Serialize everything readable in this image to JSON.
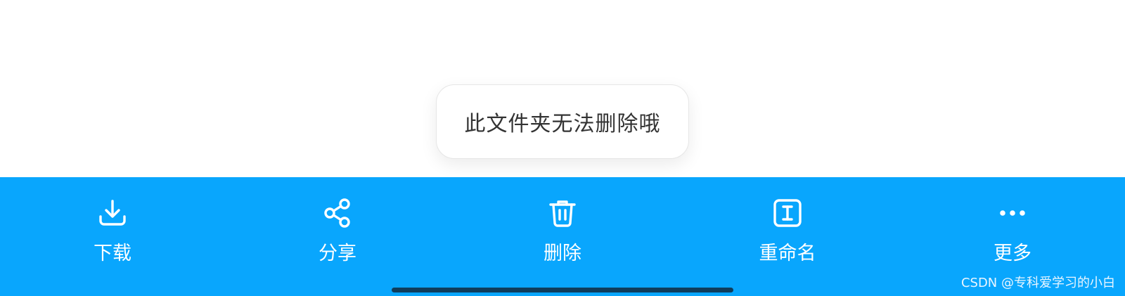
{
  "toast": {
    "message": "此文件夹无法删除哦"
  },
  "toolbar": {
    "background": "#09a6fd",
    "items": [
      {
        "label": "下载",
        "icon": "download-icon"
      },
      {
        "label": "分享",
        "icon": "share-icon"
      },
      {
        "label": "删除",
        "icon": "trash-icon"
      },
      {
        "label": "重命名",
        "icon": "rename-icon"
      },
      {
        "label": "更多",
        "icon": "more-icon"
      }
    ]
  },
  "watermark": {
    "text": "CSDN @专科爱学习的小白"
  }
}
